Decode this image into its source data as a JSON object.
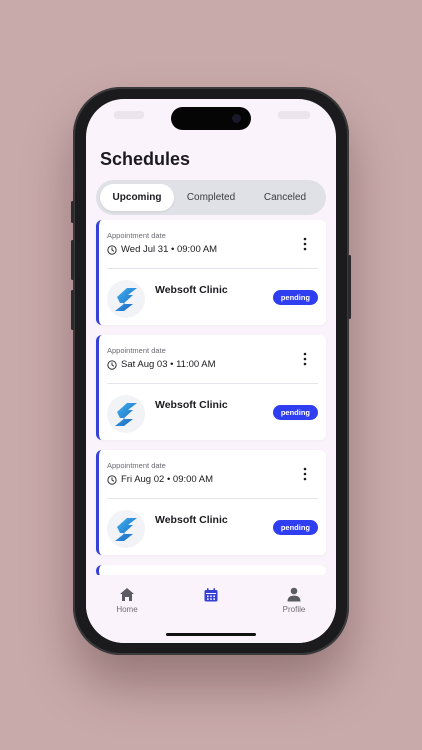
{
  "header": {
    "title": "Schedules"
  },
  "tabs": [
    {
      "label": "Upcoming",
      "active": true
    },
    {
      "label": "Completed",
      "active": false
    },
    {
      "label": "Canceled",
      "active": false
    }
  ],
  "appointments": [
    {
      "label": "Appointment date",
      "date": "Wed Jul 31 • 09:00 AM",
      "clinic": "Websoft Clinic",
      "status": "pending"
    },
    {
      "label": "Appointment date",
      "date": "Sat Aug 03 • 11:00 AM",
      "clinic": "Websoft Clinic",
      "status": "pending"
    },
    {
      "label": "Appointment date",
      "date": "Fri Aug 02 • 09:00 AM",
      "clinic": "Websoft Clinic",
      "status": "pending"
    }
  ],
  "nav": [
    {
      "label": "Home",
      "icon": "home-icon"
    },
    {
      "label": "",
      "icon": "calendar-icon",
      "active": true
    },
    {
      "label": "Profile",
      "icon": "profile-icon"
    }
  ],
  "colors": {
    "accent": "#2f3ef0",
    "card_border": "#3541d6",
    "background": "#c9aaab",
    "screen": "#fbf3fb"
  }
}
